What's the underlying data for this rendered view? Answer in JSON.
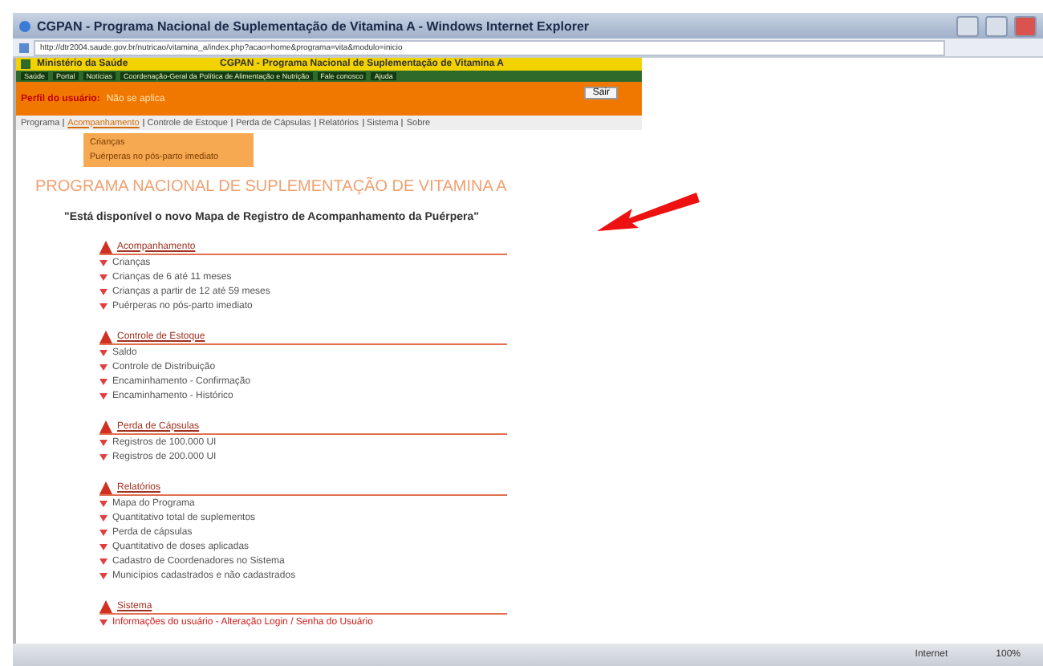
{
  "window": {
    "title": "CGPAN - Programa Nacional de Suplementação de Vitamina A - Windows Internet Explorer"
  },
  "address_bar": {
    "url": "http://dtr2004.saude.gov.br/nutricao/vitamina_a/index.php?acao=home&programa=vita&modulo=inicio"
  },
  "header": {
    "ministry": "Ministério da Saúde",
    "system_title": "CGPAN - Programa Nacional de Suplementação de Vitamina A",
    "nav_links": [
      "Saúde",
      "Portal",
      "Notícias",
      "Coordenação-Geral da Política de Alimentação e Nutrição",
      "Fale conosco",
      "Ajuda"
    ],
    "profile_label": "Perfil do usuário:",
    "profile_value": "Não se aplica",
    "logout_button": "Sair"
  },
  "menu": [
    {
      "label": "Programa",
      "selected": false
    },
    {
      "label": "Acompanhamento",
      "selected": true
    },
    {
      "label": "Controle de Estoque",
      "selected": false
    },
    {
      "label": "Perda de Cápsulas",
      "selected": false
    },
    {
      "label": "Relatórios",
      "selected": false
    },
    {
      "label": "Sistema",
      "selected": false
    },
    {
      "label": "Sobre",
      "selected": false
    }
  ],
  "dropdown": [
    "Crianças",
    "Puérperas no pós-parto imediato"
  ],
  "page": {
    "heading": "PROGRAMA NACIONAL DE SUPLEMENTAÇÃO DE VITAMINA A",
    "notice": "\"Está disponível o novo Mapa de Registro de Acompanhamento da Puérpera\""
  },
  "sections": [
    {
      "title": "Acompanhamento",
      "items": [
        {
          "label": "Crianças",
          "highlighted": false
        },
        {
          "label": "Crianças de 6 até 11 meses",
          "highlighted": false
        },
        {
          "label": "Crianças a partir de 12 até 59 meses",
          "highlighted": false
        },
        {
          "label": "Puérperas no pós-parto imediato",
          "highlighted": false
        }
      ]
    },
    {
      "title": "Controle de Estoque",
      "items": [
        {
          "label": "Saldo",
          "highlighted": false
        },
        {
          "label": "Controle de Distribuição",
          "highlighted": false
        },
        {
          "label": "Encaminhamento - Confirmação",
          "highlighted": false
        },
        {
          "label": "Encaminhamento - Histórico",
          "highlighted": false
        }
      ]
    },
    {
      "title": "Perda de Cápsulas",
      "items": [
        {
          "label": "Registros de 100.000 UI",
          "highlighted": false
        },
        {
          "label": "Registros de 200.000 UI",
          "highlighted": false
        }
      ]
    },
    {
      "title": "Relatórios",
      "items": [
        {
          "label": "Mapa do Programa",
          "highlighted": false
        },
        {
          "label": "Quantitativo total de suplementos",
          "highlighted": false
        },
        {
          "label": "Perda de cápsulas",
          "highlighted": false
        },
        {
          "label": "Quantitativo de doses aplicadas",
          "highlighted": false
        },
        {
          "label": "Cadastro de Coordenadores no Sistema",
          "highlighted": false
        },
        {
          "label": "Municípios cadastrados e não cadastrados",
          "highlighted": false
        }
      ]
    },
    {
      "title": "Sistema",
      "items": [
        {
          "label": "Informações do usuário - Alteração Login / Senha do Usuário",
          "highlighted": true
        }
      ]
    }
  ],
  "status_bar": {
    "zone": "Internet",
    "zoom": "100%"
  }
}
